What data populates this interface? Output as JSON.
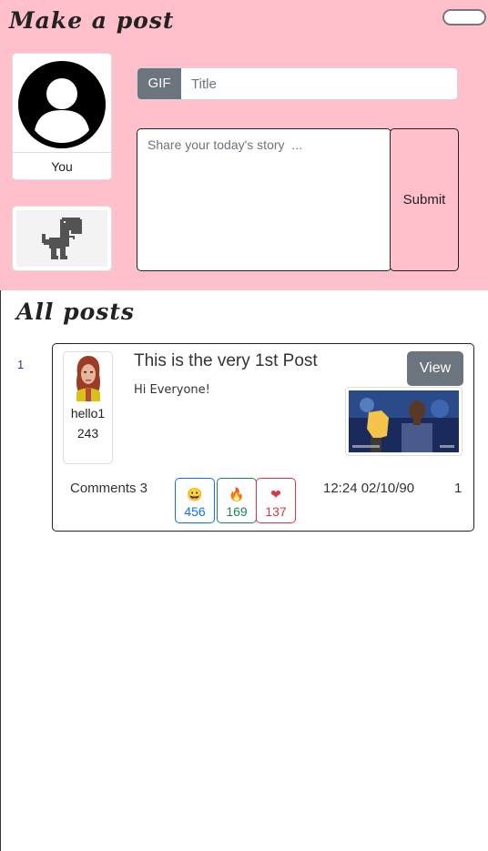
{
  "make_post": {
    "heading": "Make a post",
    "avatar_label": "You",
    "gif_button": "GIF",
    "title_placeholder": "Title",
    "story_placeholder": "Share your today's story  ...",
    "submit_label": "Submit"
  },
  "all_posts": {
    "heading": "All posts",
    "posts": [
      {
        "index": "1",
        "author_name": "hello1",
        "author_score": "243",
        "title": "This is the very 1st Post",
        "body": "Hi Everyone!",
        "view_label": "View",
        "comments_label": "Comments 3",
        "reactions": {
          "laugh": {
            "icon": "grinning-face-icon",
            "count": "456",
            "color": "#0d6efd"
          },
          "fire": {
            "icon": "fire-icon",
            "count": "169",
            "color": "#198754"
          },
          "heart": {
            "icon": "heart-icon",
            "count": "137",
            "color": "#dc3545"
          }
        },
        "timestamp": "12:24 02/10/90",
        "page": "1"
      }
    ]
  },
  "colors": {
    "header_bg": "#ffc0cb",
    "secondary_button": "#6c757d"
  }
}
